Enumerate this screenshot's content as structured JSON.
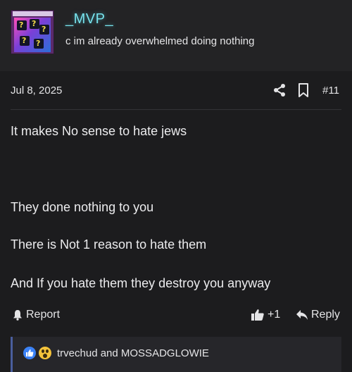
{
  "author": {
    "username": "_MVP_",
    "user_title": "c im already overwhelmed doing nothing",
    "avatar_card_name": "Magical Hats"
  },
  "post": {
    "date": "Jul 8, 2025",
    "post_number": "#11",
    "body": [
      "It makes No sense to hate jews",
      "They done nothing to you",
      "There is Not 1 reason to hate them",
      "And If you hate them they destroy you anyway"
    ]
  },
  "actions": {
    "report_label": "Report",
    "like_count": "+1",
    "reply_label": "Reply"
  },
  "reactions": {
    "text": "trvechud and MOSSADGLOWIE",
    "icons": [
      "like-reaction-icon",
      "wow-reaction-icon"
    ]
  },
  "colors": {
    "background": "#1c1c1e",
    "header_background": "#232325",
    "username": "#77e2ec",
    "reaction_accent": "#4a5e9e",
    "like_blue": "#3b82f6",
    "wow_yellow": "#f5c33b"
  }
}
